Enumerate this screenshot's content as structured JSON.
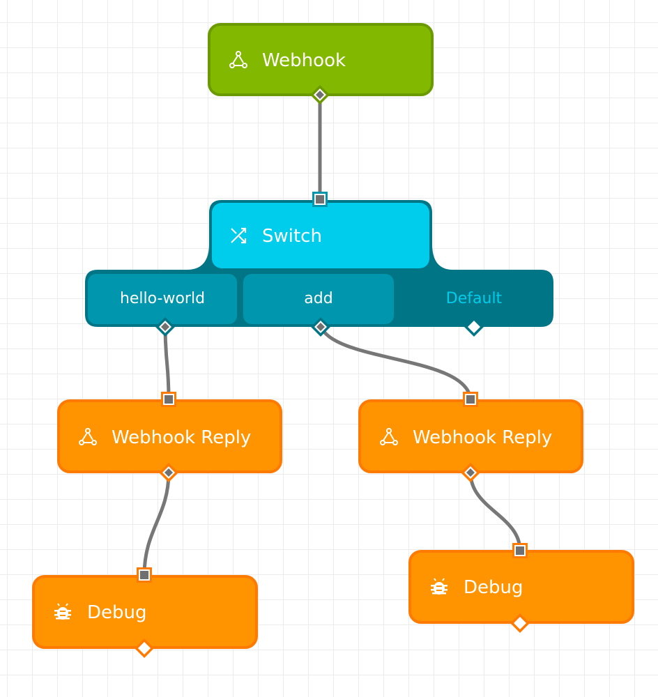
{
  "colors": {
    "webhook_fill": "#82b800",
    "webhook_border": "#6b9a00",
    "switch_fill": "#00cceb",
    "switch_border": "#007585",
    "case_fill": "#0096ad",
    "default_text": "#00cceb",
    "action_fill": "#ff9400",
    "action_border": "#ff7a00",
    "edge": "#777777",
    "port_fill": "#707070"
  },
  "nodes": {
    "webhook": {
      "label": "Webhook",
      "icon": "webhook-icon"
    },
    "switch": {
      "label": "Switch",
      "icon": "shuffle-icon",
      "cases": [
        "hello-world",
        "add"
      ],
      "default_label": "Default"
    },
    "reply_left": {
      "label": "Webhook Reply",
      "icon": "webhook-icon"
    },
    "reply_right": {
      "label": "Webhook Reply",
      "icon": "webhook-icon"
    },
    "debug_left": {
      "label": "Debug",
      "icon": "bug-icon"
    },
    "debug_right": {
      "label": "Debug",
      "icon": "bug-icon"
    }
  },
  "edges": [
    {
      "from": "webhook",
      "to": "switch"
    },
    {
      "from": "switch.hello-world",
      "to": "reply_left"
    },
    {
      "from": "switch.add",
      "to": "reply_right"
    },
    {
      "from": "reply_left",
      "to": "debug_left"
    },
    {
      "from": "reply_right",
      "to": "debug_right"
    }
  ]
}
